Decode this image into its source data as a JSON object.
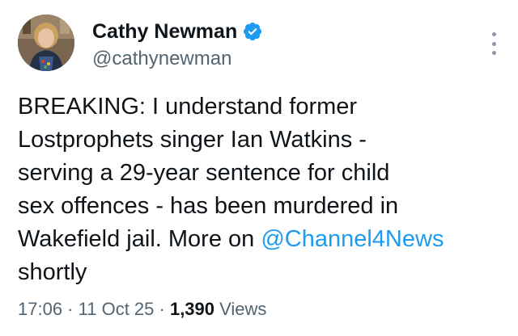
{
  "author": {
    "display_name": "Cathy Newman",
    "handle": "@cathynewman",
    "verified": true
  },
  "icons": {
    "verified": "verified-badge-icon",
    "more": "more-options-icon"
  },
  "tweet": {
    "line1": "BREAKING: I understand former",
    "line2": "Lostprophets singer Ian Watkins -",
    "line3": "serving a 29-year sentence for child",
    "line4": "sex offences - has been murdered in",
    "line5_text": "Wakefield jail. More on ",
    "line5_mention": "@Channel4News",
    "line6": "shortly"
  },
  "meta": {
    "time": "17:06",
    "sep1": " · ",
    "date": "11 Oct 25",
    "sep2": " · ",
    "views_count": "1,390",
    "views_label": " Views"
  },
  "colors": {
    "accent": "#1d9bf0",
    "text": "#0f1419",
    "secondary": "#536471"
  }
}
